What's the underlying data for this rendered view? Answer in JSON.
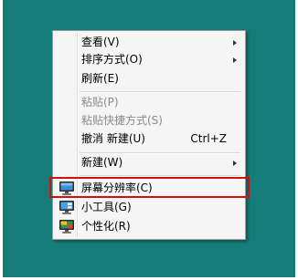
{
  "context_menu": {
    "items": [
      {
        "label": "查看(V)",
        "submenu": true
      },
      {
        "label": "排序方式(O)",
        "submenu": true
      },
      {
        "label": "刷新(E)"
      },
      {
        "label": "粘贴(P)",
        "disabled": true
      },
      {
        "label": "粘贴快捷方式(S)",
        "disabled": true
      },
      {
        "label": "撤消 新建(U)",
        "shortcut": "Ctrl+Z"
      },
      {
        "label": "新建(W)",
        "submenu": true
      },
      {
        "label": "屏幕分辨率(C)",
        "icon": "screen-resolution-icon",
        "highlighted": true
      },
      {
        "label": "小工具(G)",
        "icon": "gadgets-icon"
      },
      {
        "label": "个性化(R)",
        "icon": "personalize-icon"
      }
    ]
  },
  "colors": {
    "desktop_background": "#167c79",
    "highlight_border": "#d10f0f",
    "menu_background": "#f5f5f5"
  }
}
